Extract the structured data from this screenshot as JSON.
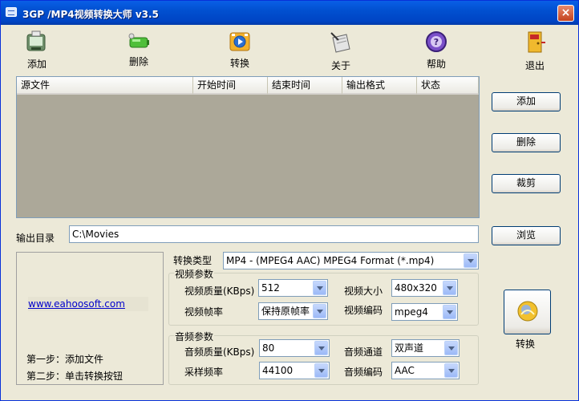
{
  "window": {
    "title": "3GP /MP4视频转换大师 v3.5",
    "close_glyph": "×"
  },
  "toolbar": [
    {
      "id": "add",
      "label": "添加",
      "icon": "add-file-icon"
    },
    {
      "id": "delete",
      "label": "删除",
      "icon": "delete-battery-icon"
    },
    {
      "id": "convert",
      "label": "转换",
      "icon": "convert-film-icon"
    },
    {
      "id": "about",
      "label": "关于",
      "icon": "about-icon"
    },
    {
      "id": "help",
      "label": "帮助",
      "icon": "help-icon"
    },
    {
      "id": "exit",
      "label": "退出",
      "icon": "exit-door-icon"
    }
  ],
  "list": {
    "columns": [
      "源文件",
      "开始时间",
      "结束时间",
      "输出格式",
      "状态"
    ],
    "rows": []
  },
  "side_buttons": {
    "add": "添加",
    "delete": "删除",
    "crop": "裁剪",
    "browse": "浏览"
  },
  "output": {
    "label": "输出目录",
    "value": "C:\\Movies"
  },
  "info": {
    "url": "www.eahoosoft.com",
    "step1": "第一步：添加文件",
    "step2": "第二步：单击转换按钮"
  },
  "convert_type": {
    "label": "转换类型",
    "value": "MP4 - (MPEG4 AAC) MPEG4 Format (*.mp4)"
  },
  "video": {
    "group": "视频参数",
    "quality_label": "视频质量(KBps)",
    "quality_value": "512",
    "size_label": "视频大小",
    "size_value": "480x320",
    "fps_label": "视频帧率",
    "fps_value": "保持原帧率",
    "codec_label": "视频编码",
    "codec_value": "mpeg4"
  },
  "audio": {
    "group": "音频参数",
    "quality_label": "音频质量(KBps)",
    "quality_value": "80",
    "channel_label": "音频通道",
    "channel_value": "双声道",
    "rate_label": "采样频率",
    "rate_value": "44100",
    "codec_label": "音频编码",
    "codec_value": "AAC"
  },
  "convert_button": {
    "label": "转换",
    "icon": "convert-globe-icon"
  },
  "colors": {
    "titlebar": "#0054e3",
    "face": "#ece9d8",
    "list_bg": "#aca899",
    "link": "#0000cc"
  }
}
